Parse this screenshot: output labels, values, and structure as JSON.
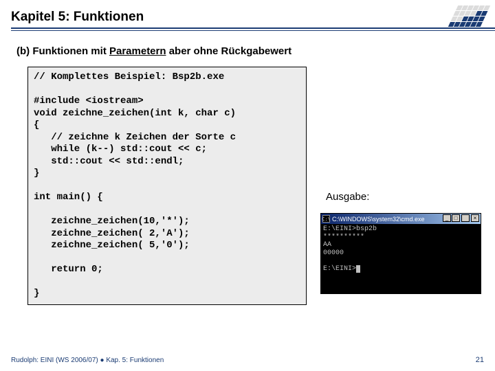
{
  "header": {
    "title": "Kapitel 5: Funktionen"
  },
  "subtitle": {
    "prefix": "(b) Funktionen mit ",
    "underlined": "Parametern",
    "suffix": " aber ohne Rückgabewert"
  },
  "code": "// Komplettes Beispiel: Bsp2b.exe\n\n#include <iostream>\nvoid zeichne_zeichen(int k, char c)\n{\n   // zeichne k Zeichen der Sorte c\n   while (k--) std::cout << c;\n   std::cout << std::endl;\n}\n\nint main() {\n\n   zeichne_zeichen(10,'*');\n   zeichne_zeichen( 2,'A');\n   zeichne_zeichen( 5,'0');\n\n   return 0;\n\n}",
  "output_label": "Ausgabe:",
  "console": {
    "title_icon_text": "C:\\",
    "title": "C:\\WINDOWS\\system32\\cmd.exe",
    "output": "E:\\EINI>bsp2b\n**********\nAA\n00000\n\nE:\\EINI>"
  },
  "footer": {
    "text": "Rudolph: EINI (WS 2006/07)  ●  Kap. 5: Funktionen",
    "page": "21"
  }
}
